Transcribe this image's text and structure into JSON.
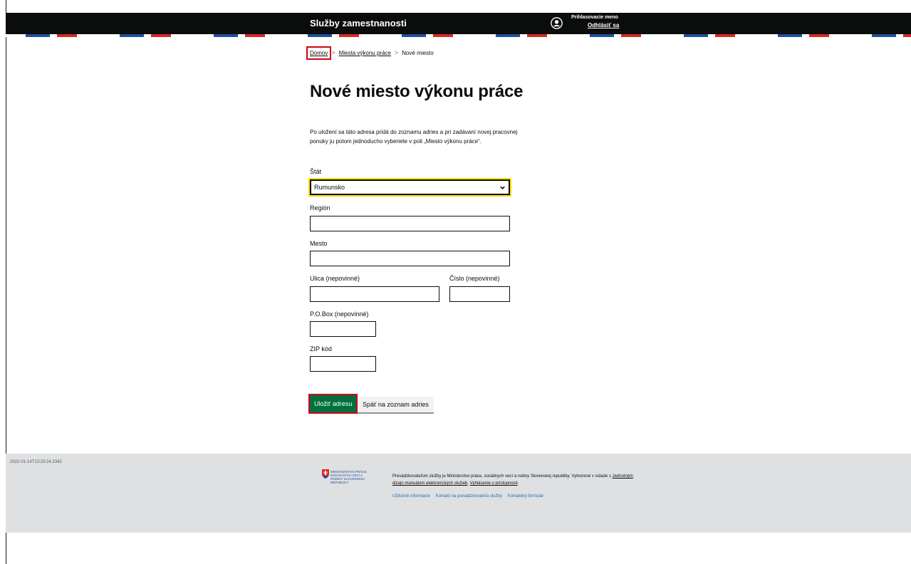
{
  "header": {
    "service_title": "Služby zamestnanosti",
    "login_name": "Prihlasovacie meno",
    "logout_label": "Odhlásiť sa"
  },
  "breadcrumb": {
    "home": "Domov",
    "places": "Miesta výkonu práce",
    "current": "Nové miesto",
    "separator": ">"
  },
  "main": {
    "title": "Nové miesto výkonu práce",
    "intro": "Po uložení sa táto adresa pridá do zoznamu adries a pri zadávaní novej pracovnej ponuky ju potom jednoducho vyberiete v poli „Miesto výkonu práce“."
  },
  "form": {
    "country": {
      "label": "Štát",
      "value": "Rumunsko"
    },
    "region": {
      "label": "Región",
      "value": ""
    },
    "city": {
      "label": "Mesto",
      "value": ""
    },
    "street": {
      "label": "Ulica (nepovinné)",
      "value": ""
    },
    "number": {
      "label": "Číslo (nepovinné)",
      "value": ""
    },
    "pobox": {
      "label": "P.O.Box (nepovinné)",
      "value": ""
    },
    "zip": {
      "label": "ZIP kód",
      "value": ""
    },
    "save_label": "Uložiť adresu",
    "back_label": "Späť na zoznam adries"
  },
  "footer": {
    "timestamp": "2022-01-14T13:23:24.2342",
    "logo_text": "MINISTERSTVO PRÁCE, SOCIÁLNYCH VECÍ A RODINY SLOVENSKEJ REPUBLIKY",
    "operator_text": "Prevádzkovateľom služby je Ministerstvo práce, sociálnych vecí a rodiny Slovenskej republiky. Vytvorené v súlade s",
    "design_link": "Jednotným dizajn manuálom elektronických služieb",
    "accessibility_link": "Vyhlásenie o prístupnosti",
    "links": [
      "Užitočné informácie",
      "Kontakt na prevádzkovateľa služby",
      "Kontaktný formulár"
    ]
  },
  "colors": {
    "header_bg": "#0b0c0c",
    "primary_button": "#00703c",
    "focus_yellow": "#ffdd00",
    "highlight_red": "#d0021b",
    "footer_bg": "#dee0e2"
  }
}
